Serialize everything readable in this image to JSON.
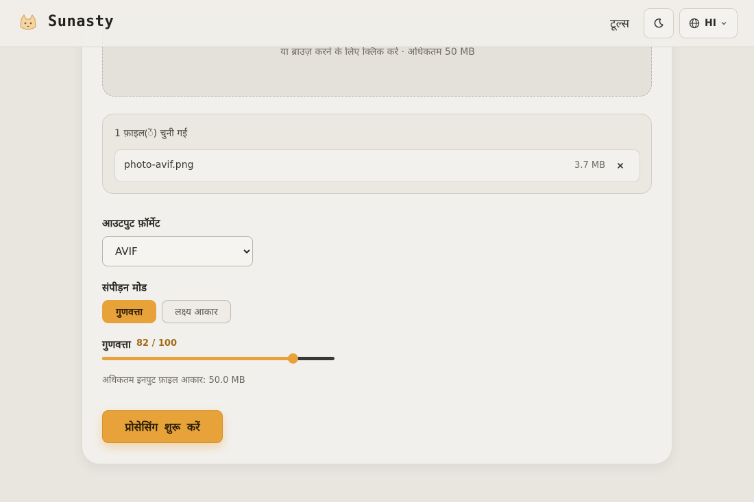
{
  "header": {
    "brand": "Sunasty",
    "nav_tools": "टूल्स",
    "language": "HI"
  },
  "dropzone": {
    "hint": "या ब्राउज़ करने के लिए क्लिक करें · अधिकतम 50 MB"
  },
  "files": {
    "count_label": "1 फ़ाइल(ें) चुनी गई",
    "items": [
      {
        "name": "photo-avif.png",
        "size": "3.7 MB"
      }
    ]
  },
  "output_format": {
    "label": "आउटपुट फ़ॉर्मेट",
    "selected": "AVIF"
  },
  "compression": {
    "label": "संपीड़न मोड",
    "modes": [
      "गुणवत्ता",
      "लक्ष्य आकार"
    ],
    "active_mode": "गुणवत्ता"
  },
  "quality": {
    "label": "गुणवत्ता",
    "value_text": "82 / 100",
    "value": 82,
    "max": 100
  },
  "max_input_note": "अधिकतम इनपुट फ़ाइल आकार: 50.0 MB",
  "process_button": "प्रोसेसिंग शुरू करें",
  "next_section_heading": "",
  "colors": {
    "accent": "#e8a23a",
    "background": "#e9e6e0",
    "card": "#f2f0ec"
  }
}
